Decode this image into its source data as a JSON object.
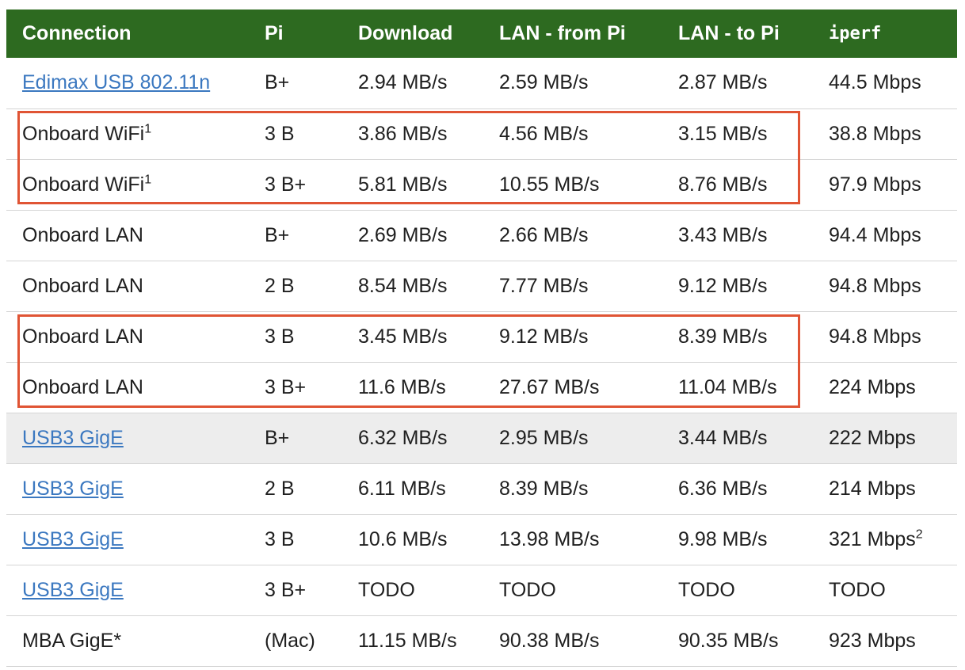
{
  "table": {
    "headers": [
      "Connection",
      "Pi",
      "Download",
      "LAN - from Pi",
      "LAN - to Pi",
      "iperf"
    ],
    "rows": [
      {
        "connection": "Edimax USB 802.11n",
        "pi": "B+",
        "download": "2.94 MB/s",
        "lan_from": "2.59 MB/s",
        "lan_to": "2.87 MB/s",
        "iperf": "44.5 Mbps"
      },
      {
        "connection": "Onboard WiFi",
        "connection_note": "1",
        "pi": "3 B",
        "download": "3.86 MB/s",
        "lan_from": "4.56 MB/s",
        "lan_to": "3.15 MB/s",
        "iperf": "38.8 Mbps"
      },
      {
        "connection": "Onboard WiFi",
        "connection_note": "1",
        "pi": "3 B+",
        "download": "5.81 MB/s",
        "lan_from": "10.55 MB/s",
        "lan_to": "8.76 MB/s",
        "iperf": "97.9 Mbps"
      },
      {
        "connection": "Onboard LAN",
        "pi": "B+",
        "download": "2.69 MB/s",
        "lan_from": "2.66 MB/s",
        "lan_to": "3.43 MB/s",
        "iperf": "94.4 Mbps"
      },
      {
        "connection": "Onboard LAN",
        "pi": "2 B",
        "download": "8.54 MB/s",
        "lan_from": "7.77 MB/s",
        "lan_to": "9.12 MB/s",
        "iperf": "94.8 Mbps"
      },
      {
        "connection": "Onboard LAN",
        "pi": "3 B",
        "download": "3.45 MB/s",
        "lan_from": "9.12 MB/s",
        "lan_to": "8.39 MB/s",
        "iperf": "94.8 Mbps"
      },
      {
        "connection": "Onboard LAN",
        "pi": "3 B+",
        "download": "11.6 MB/s",
        "lan_from": "27.67 MB/s",
        "lan_to": "11.04 MB/s",
        "iperf": "224 Mbps"
      },
      {
        "connection": "USB3 GigE",
        "pi": "B+",
        "download": "6.32 MB/s",
        "lan_from": "2.95 MB/s",
        "lan_to": "3.44 MB/s",
        "iperf": "222 Mbps"
      },
      {
        "connection": "USB3 GigE",
        "pi": "2 B",
        "download": "6.11 MB/s",
        "lan_from": "8.39 MB/s",
        "lan_to": "6.36 MB/s",
        "iperf": "214 Mbps"
      },
      {
        "connection": "USB3 GigE",
        "pi": "3 B",
        "download": "10.6 MB/s",
        "lan_from": "13.98 MB/s",
        "lan_to": "9.98 MB/s",
        "iperf": "321 Mbps",
        "iperf_note": "2"
      },
      {
        "connection": "USB3 GigE",
        "pi": "3 B+",
        "download": "TODO",
        "lan_from": "TODO",
        "lan_to": "TODO",
        "iperf": "TODO"
      },
      {
        "connection": "MBA GigE*",
        "pi": "(Mac)",
        "download": "11.15 MB/s",
        "lan_from": "90.38 MB/s",
        "lan_to": "90.35 MB/s",
        "iperf": "923 Mbps"
      }
    ]
  },
  "colors": {
    "header_bg": "#2d6a20",
    "header_text": "#ffffff",
    "link": "#3b78c0",
    "highlight_border": "#e05434",
    "shaded_row": "#ededed"
  }
}
